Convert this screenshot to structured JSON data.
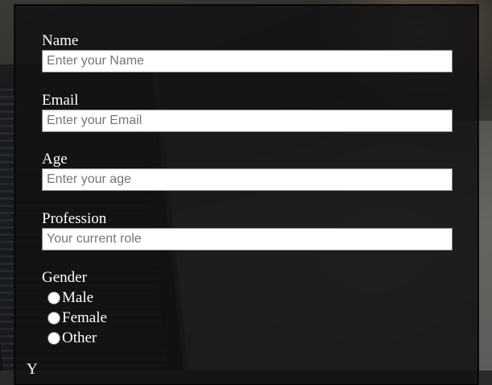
{
  "form": {
    "name": {
      "label": "Name",
      "placeholder": "Enter your Name",
      "value": ""
    },
    "email": {
      "label": "Email",
      "placeholder": "Enter your Email",
      "value": ""
    },
    "age": {
      "label": "Age",
      "placeholder": "Enter your age",
      "value": ""
    },
    "profession": {
      "label": "Profession",
      "placeholder": "Your current role",
      "value": ""
    },
    "gender": {
      "label": "Gender",
      "options": [
        "Male",
        "Female",
        "Other"
      ],
      "selected": null
    },
    "next_label_partial": "Y"
  },
  "colors": {
    "panel_bg": "#121212",
    "label_text": "#ffffff",
    "input_bg": "#ffffff",
    "placeholder": "#757575"
  }
}
